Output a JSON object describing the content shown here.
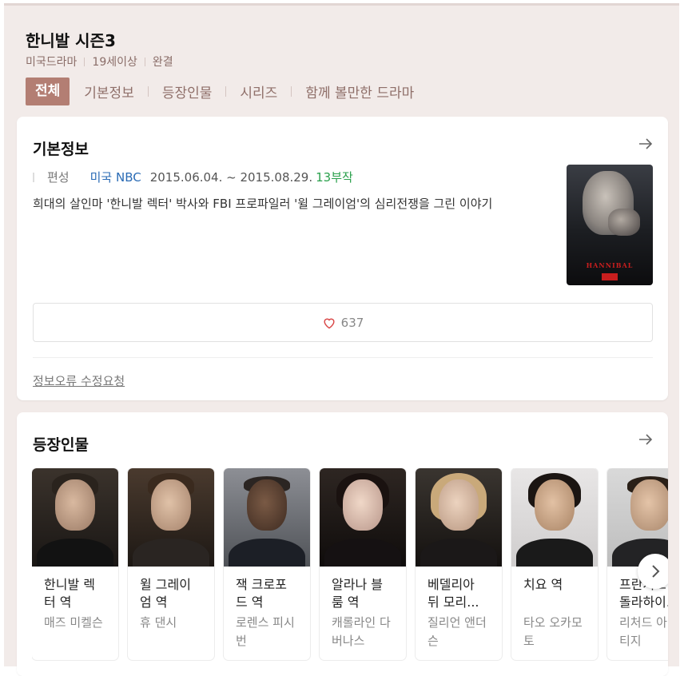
{
  "header": {
    "title": "한니발 시즌3",
    "meta": [
      "미국드라마",
      "19세이상",
      "완결"
    ]
  },
  "tabs": [
    {
      "label": "전체",
      "active": true
    },
    {
      "label": "기본정보",
      "active": false
    },
    {
      "label": "등장인물",
      "active": false
    },
    {
      "label": "시리즈",
      "active": false
    },
    {
      "label": "함께 볼만한 드라마",
      "active": false
    }
  ],
  "basic_info": {
    "title": "기본정보",
    "label": "편성",
    "network": "미국 NBC",
    "dates": "2015.06.04. ~ 2015.08.29.",
    "episodes": "13부작",
    "description": "희대의 살인마 '한니발 렉터' 박사와 FBI 프로파일러 '윌 그레이엄'의 심리전쟁을 그린 이야기",
    "poster_text": "HANNIBAL",
    "likes": "637",
    "report_link": "정보오류 수정요청"
  },
  "cast": {
    "title": "등장인물",
    "items": [
      {
        "role": "한니발 렉터 역",
        "actor": "매즈 미켈슨"
      },
      {
        "role": "윌 그레이엄 역",
        "actor": "휴 댄시"
      },
      {
        "role": "잭 크로포드 역",
        "actor": "로렌스 피시번"
      },
      {
        "role": "알라나 블룸 역",
        "actor": "캐롤라인 다버나스"
      },
      {
        "role": "베델리아 뒤 모리...",
        "actor": "질리언 앤더슨"
      },
      {
        "role": "치요 역",
        "actor": "타오 오카모토"
      },
      {
        "role": "프란시스 돌라하이...",
        "actor": "리처드 아미티지"
      }
    ]
  },
  "colors": {
    "accent": "#b37e73",
    "background": "#f2ebe9",
    "link_blue": "#2a6bb5",
    "episodes_green": "#2aa04c"
  }
}
